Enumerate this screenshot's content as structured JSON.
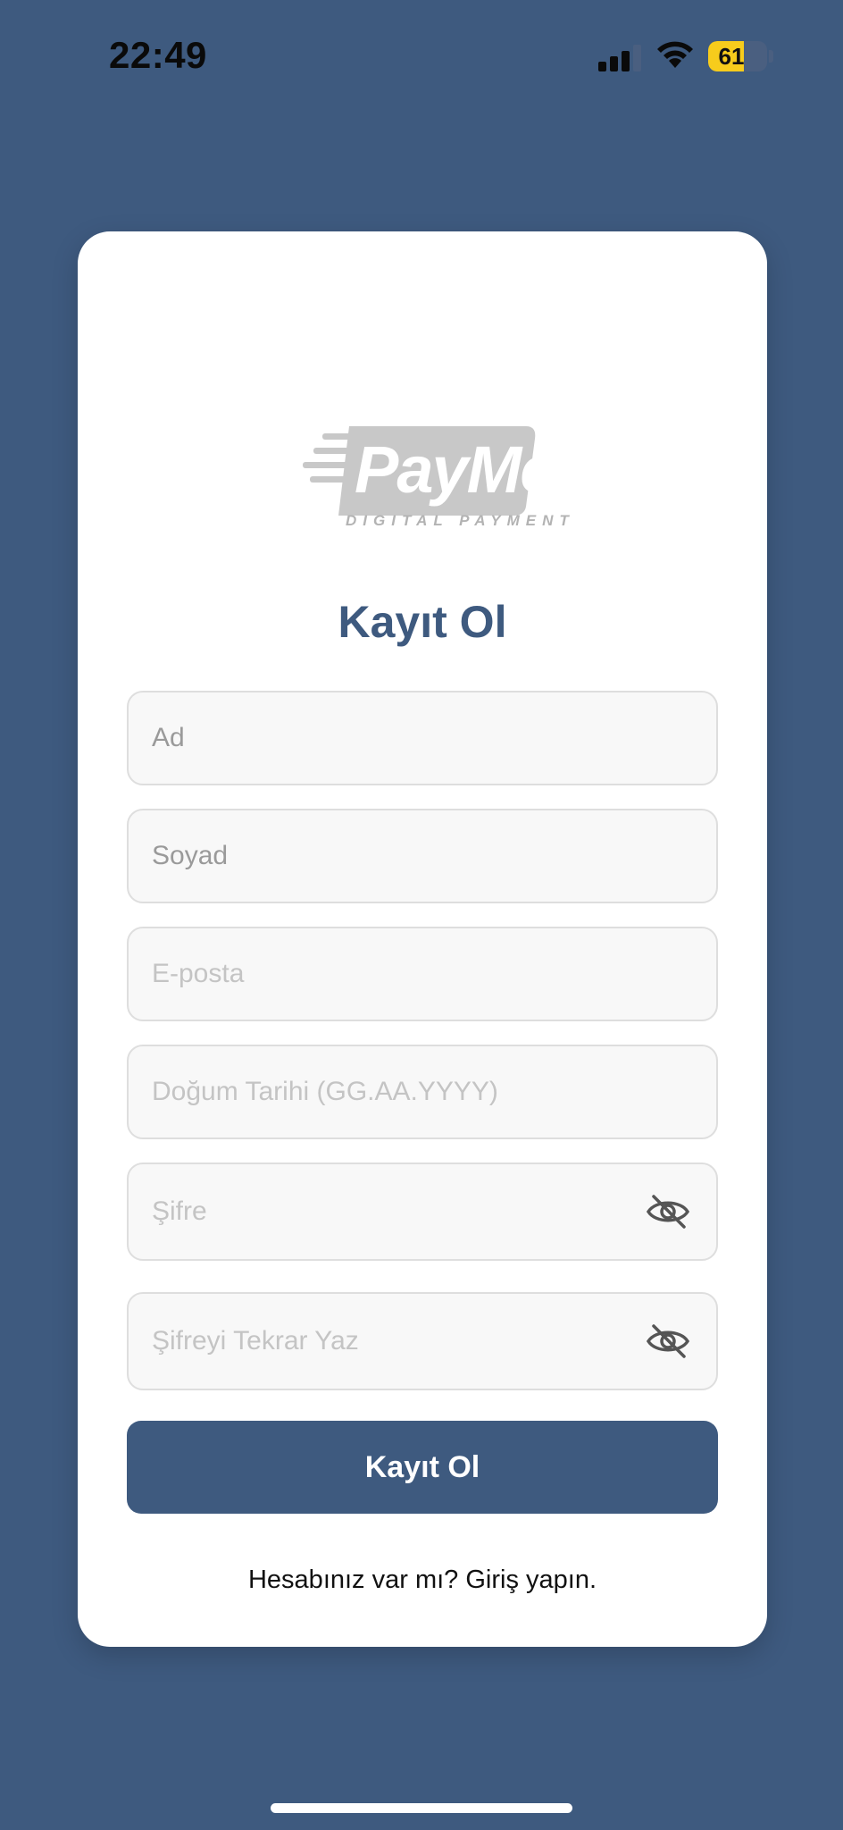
{
  "status_bar": {
    "time": "22:49",
    "battery_level": "61",
    "battery_fraction": 0.61,
    "icons": [
      "cellular-signal-icon",
      "wifi-icon",
      "battery-icon"
    ]
  },
  "logo": {
    "wordmark": "PayMe",
    "tagline": "DIGITAL PAYMENT"
  },
  "form": {
    "title": "Kayıt Ol",
    "fields": [
      {
        "name": "first-name",
        "placeholder": "Ad"
      },
      {
        "name": "last-name",
        "placeholder": "Soyad"
      },
      {
        "name": "email",
        "placeholder": "E-posta"
      },
      {
        "name": "birth-date",
        "placeholder": "Doğum Tarihi (GG.AA.YYYY)"
      },
      {
        "name": "password",
        "placeholder": "Şifre",
        "icon": "eye-slash-icon"
      },
      {
        "name": "password-confirm",
        "placeholder": "Şifreyi Tekrar Yaz",
        "icon": "eye-slash-icon"
      }
    ],
    "submit_label": "Kayıt Ol",
    "login_prompt": "Hesabınız var mı? Giriş yapın."
  },
  "colors": {
    "background": "#3e5a7f",
    "primary": "#3e5a7f",
    "card": "#ffffff",
    "field_bg": "#f8f8f8",
    "battery": "#f7cc1c"
  }
}
